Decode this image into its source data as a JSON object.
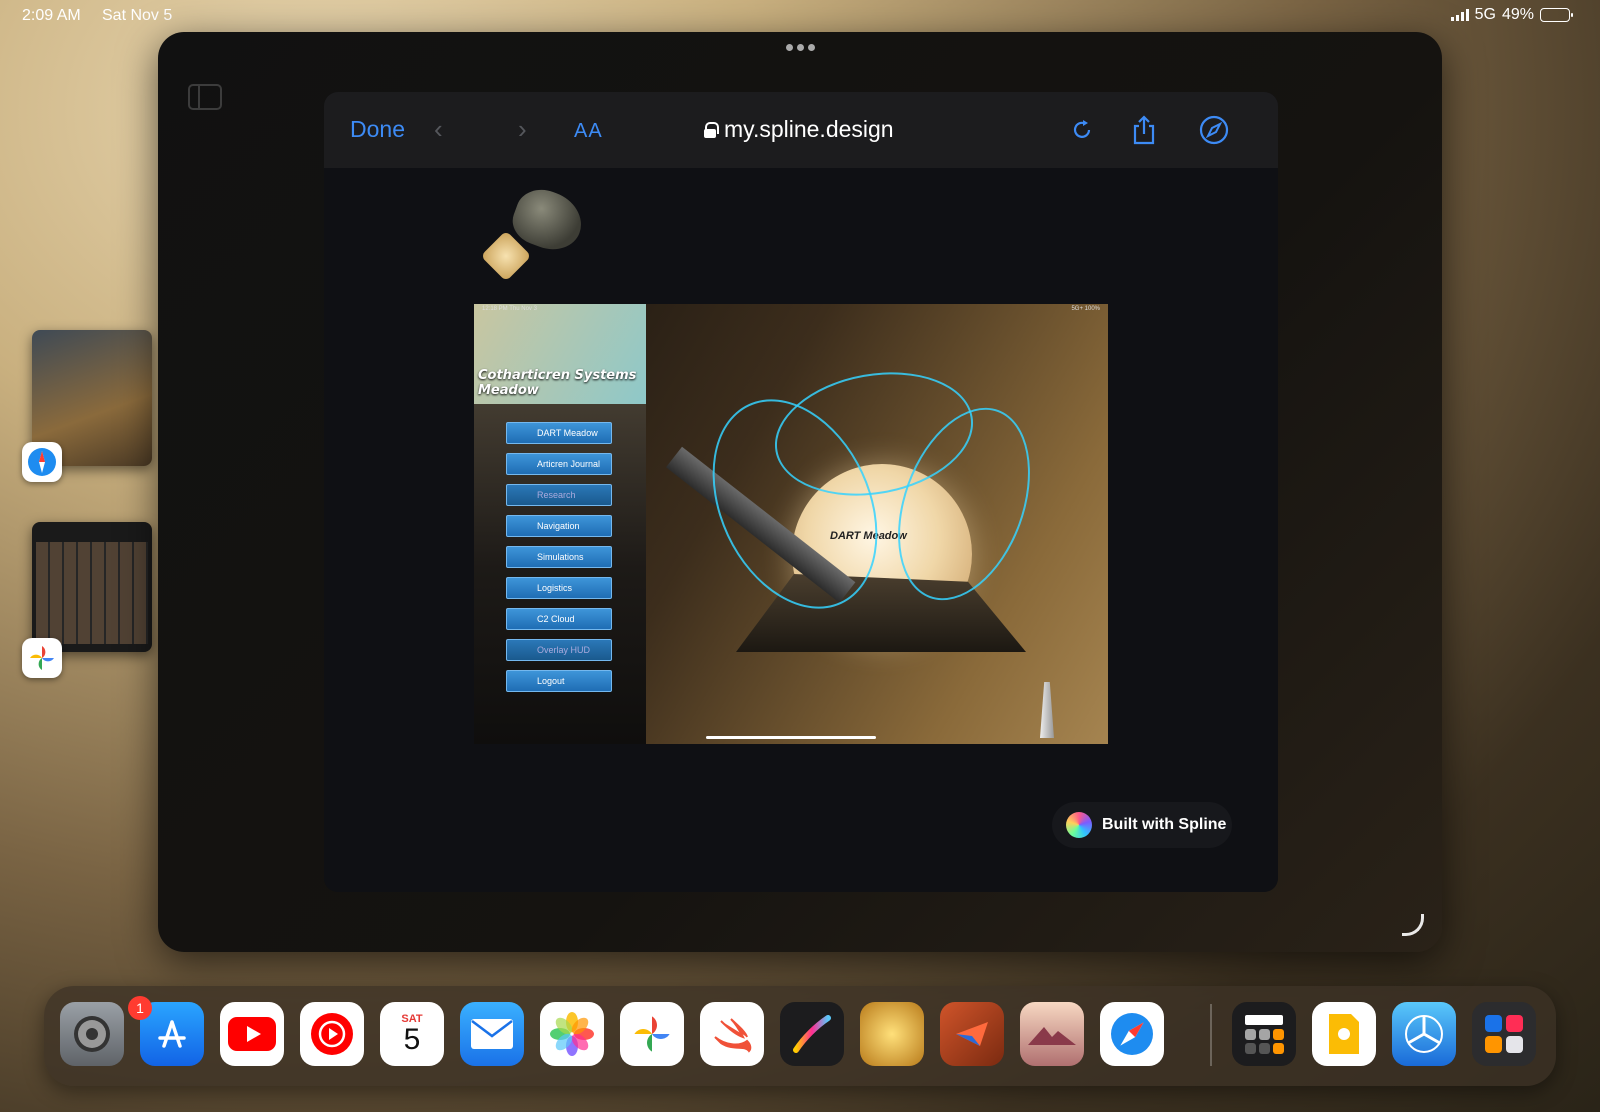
{
  "status_bar": {
    "time": "2:09 AM",
    "date": "Sat Nov 5",
    "network": "5G",
    "battery": "49%",
    "battery_level": 0.49
  },
  "safari": {
    "done_label": "Done",
    "text_size_label": "AA",
    "url": "my.spline.design",
    "accent_color": "#3d8bf5"
  },
  "embed": {
    "status_time": "12:18 PM  Thu Nov 3",
    "status_right": "5G+ 100%",
    "title": "Cotharticren Systems Meadow",
    "menu": [
      {
        "label": "DART Meadow"
      },
      {
        "label": "Articren Journal"
      },
      {
        "label": "Research"
      },
      {
        "label": "Navigation"
      },
      {
        "label": "Simulations"
      },
      {
        "label": "Logistics"
      },
      {
        "label": "C2 Cloud"
      },
      {
        "label": "Overlay HUD"
      },
      {
        "label": "Logout"
      }
    ],
    "moon_label": "DART Meadow"
  },
  "spline_badge": "Built with Spline",
  "dock": {
    "settings_badge": "1",
    "calendar_day": "SAT",
    "calendar_date": "5",
    "apps": [
      "settings-icon",
      "app-store-icon",
      "youtube-icon",
      "youtube-music-icon",
      "calendar-icon",
      "mail-icon",
      "photos-icon",
      "google-photos-icon",
      "swift-playgrounds-icon",
      "procreate-icon",
      "dart-meadow-icon",
      "cotharticren-icon",
      "journey-icon",
      "safari-icon",
      "calculator-icon",
      "keynote-icon",
      "testflight-icon",
      "app-library-icon"
    ]
  }
}
